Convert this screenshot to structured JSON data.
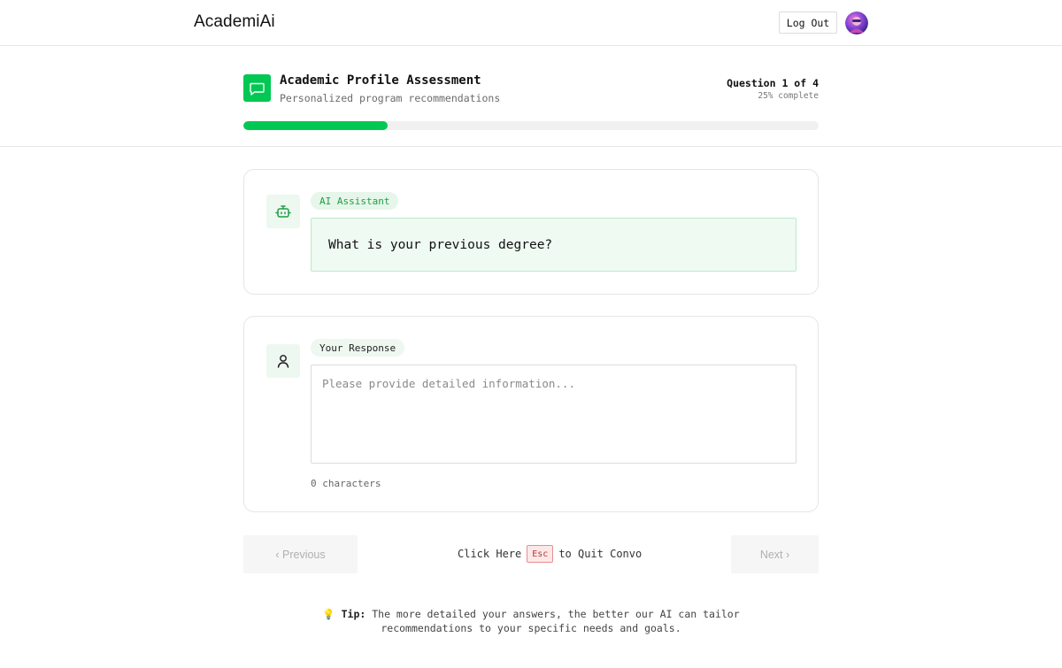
{
  "brand": {
    "name": "AcademiAi"
  },
  "header": {
    "logout_label": "Log Out",
    "avatar_icon": "user-avatar-photo"
  },
  "assessment": {
    "title": "Academic Profile Assessment",
    "subtitle": "Personalized program recommendations",
    "question_counter": "Question 1 of 4",
    "percent_label": "25% complete",
    "progress": 0.25,
    "icon": "chat-bubble-icon"
  },
  "ai_card": {
    "label": "AI Assistant",
    "question": "What is your previous degree?",
    "icon": "robot-icon"
  },
  "response_card": {
    "label": "Your Response",
    "placeholder": "Please provide detailed information...",
    "value": "",
    "char_count": "0 characters",
    "icon": "user-icon"
  },
  "nav": {
    "previous_label": "‹  Previous",
    "next_label": "Next  ›",
    "quit_prefix": "Click Here",
    "esc_key": "Esc",
    "quit_suffix": "to Quit Convo"
  },
  "tip": {
    "emoji": "💡",
    "label": "Tip:",
    "line1": "The more detailed your answers, the better our AI can tailor",
    "line2": "recommendations to your specific needs and goals."
  },
  "colors": {
    "accent": "#00c853",
    "accent_dark": "#1f9e46",
    "question_bg": "#eefaf2",
    "esc_bg": "#fde8e8"
  }
}
